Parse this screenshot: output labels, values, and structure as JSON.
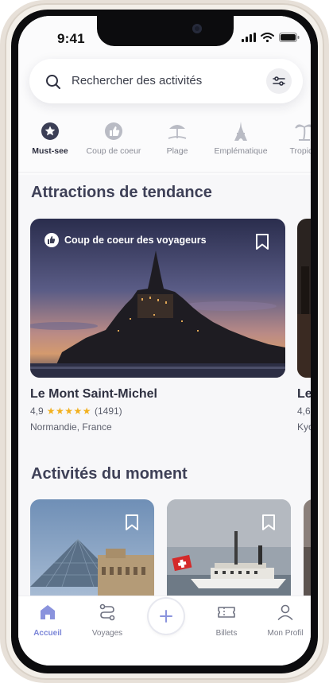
{
  "status_bar": {
    "time": "9:41"
  },
  "search": {
    "placeholder": "Rechercher des activités"
  },
  "categories": [
    {
      "label": "Must-see",
      "icon": "star-badge-icon",
      "active": true
    },
    {
      "label": "Coup de coeur",
      "icon": "thumbs-up-icon",
      "active": false
    },
    {
      "label": "Plage",
      "icon": "beach-umbrella-icon",
      "active": false
    },
    {
      "label": "Emplématique",
      "icon": "eiffel-tower-icon",
      "active": false
    },
    {
      "label": "Tropical",
      "icon": "palm-tree-icon",
      "active": false
    }
  ],
  "trending": {
    "title": "Attractions de tendance",
    "items": [
      {
        "badge": "Coup de coeur des voyageurs",
        "name": "Le Mont Saint-Michel",
        "rating": "4,9",
        "stars": "★★★★★",
        "reviews": "(1491)",
        "location": "Normandie, France"
      },
      {
        "name": "Le",
        "rating": "4,6",
        "location": "Kyo"
      }
    ]
  },
  "moment": {
    "title": "Activités du moment"
  },
  "tabs": [
    {
      "label": "Accueil",
      "icon": "home-icon",
      "active": true
    },
    {
      "label": "Voyages",
      "icon": "route-icon",
      "active": false
    },
    {
      "label": "",
      "icon": "plus-icon",
      "active": false
    },
    {
      "label": "Billets",
      "icon": "ticket-icon",
      "active": false
    },
    {
      "label": "Mon Profil",
      "icon": "user-icon",
      "active": false
    }
  ],
  "colors": {
    "accent": "#7b86d8",
    "title": "#3e4057",
    "stars": "#f2b01e"
  }
}
